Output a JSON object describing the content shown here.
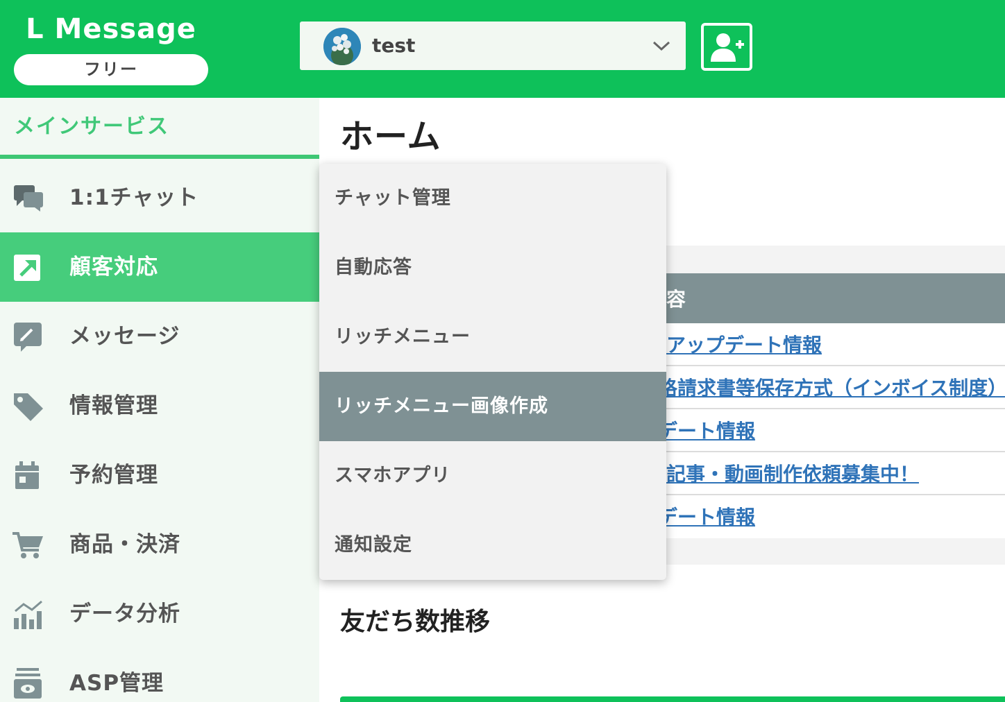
{
  "brand": {
    "title": "L Message",
    "plan": "フリー"
  },
  "account": {
    "name": "test",
    "avatar": "account-avatar"
  },
  "header": {
    "add_friend_icon": "add-user-icon"
  },
  "sidebar": {
    "section_title": "メインサービス",
    "items": [
      {
        "label": "1:1チャット",
        "icon": "chat-bubbles-icon"
      },
      {
        "label": "顧客対応",
        "icon": "external-link-icon"
      },
      {
        "label": "メッセージ",
        "icon": "edit-message-icon"
      },
      {
        "label": "情報管理",
        "icon": "tag-icon"
      },
      {
        "label": "予約管理",
        "icon": "calendar-icon"
      },
      {
        "label": "商品・決済",
        "icon": "cart-icon"
      },
      {
        "label": "データ分析",
        "icon": "analytics-icon"
      },
      {
        "label": "ASP管理",
        "icon": "asp-icon"
      }
    ],
    "active_index": 1
  },
  "main": {
    "title": "ホーム",
    "news_header": "容",
    "news": [
      "アップデート情報",
      "格請求書等保存方式（インボイス制度）に",
      "デート情報",
      "記事・動画制作依頼募集中！",
      "デート情報"
    ],
    "section2_title": "友だち数推移"
  },
  "dropdown": {
    "items": [
      "チャット管理",
      "自動応答",
      "リッチメニュー",
      "リッチメニュー画像作成",
      "スマホアプリ",
      "通知設定"
    ],
    "active_index": 3
  },
  "colors": {
    "brand_green": "#0ec15a",
    "active_green": "#46cd7c",
    "slate": "#7f9194",
    "link_blue": "#2f73b8"
  }
}
